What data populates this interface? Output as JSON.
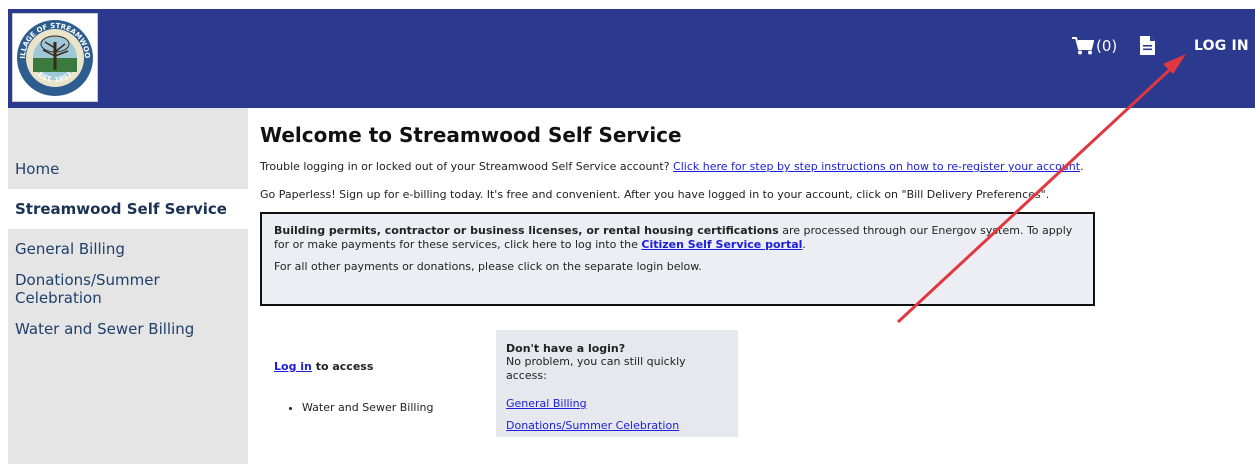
{
  "header": {
    "logo_text_top": "VILLAGE OF STREAMWOOD",
    "logo_text_bottom": "EST. 1957",
    "cart_count": "(0)",
    "login_label": "LOG IN"
  },
  "sidebar": {
    "items": [
      {
        "label": "Home"
      },
      {
        "label": "Streamwood Self Service"
      },
      {
        "label": "General Billing"
      },
      {
        "label": "Donations/Summer Celebration"
      },
      {
        "label": "Water and Sewer Billing"
      }
    ]
  },
  "main": {
    "title": "Welcome to Streamwood Self Service",
    "trouble_text": "Trouble logging in or locked out of your Streamwood Self Service account? ",
    "trouble_link": "Click here for step by step instructions on how to re-register your account",
    "trouble_end": ".",
    "paperless_text": "Go Paperless! Sign up for e-billing today. It's free and convenient. After you have logged in to your account, click on \"Bill Delivery Preferences\".",
    "notice": {
      "bold": "Building permits, contractor or business licenses, or rental housing certifications",
      "text1": " are processed through our Energov system. To apply for or make payments for these services, click here to log into the ",
      "link": "Citizen Self Service portal",
      "text1_end": ".",
      "text2": "For all other payments or donations, please click on the separate login below."
    },
    "login_block": {
      "link": "Log in",
      "text": " to access",
      "items": [
        "Water and Sewer Billing"
      ]
    },
    "no_login": {
      "heading": "Don't have a login?",
      "sub": "No problem, you can still quickly access:",
      "links": [
        "General Billing",
        "Donations/Summer Celebration"
      ]
    }
  },
  "colors": {
    "header_bg": "#2b3a8f",
    "sidebar_bg": "#e5e5e5",
    "annotation_arrow": "#e0383e"
  }
}
